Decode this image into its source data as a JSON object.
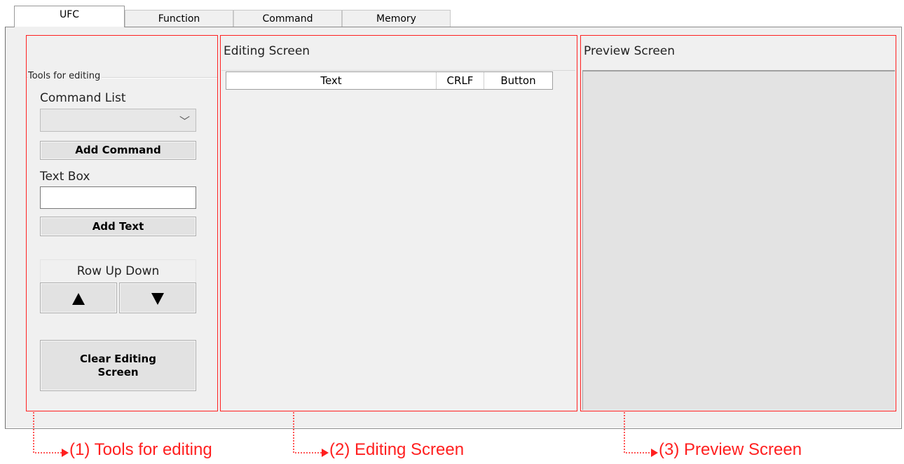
{
  "tabs": [
    {
      "label": "UFC",
      "active": true
    },
    {
      "label": "Function",
      "active": false
    },
    {
      "label": "Command",
      "active": false
    },
    {
      "label": "Memory",
      "active": false
    }
  ],
  "tools": {
    "group_label": "Tools for editing",
    "command_list_label": "Command List",
    "command_list_value": "",
    "add_command_label": "Add Command",
    "text_box_label": "Text Box",
    "text_box_value": "",
    "add_text_label": "Add Text",
    "row_up_down_label": "Row Up Down",
    "up_symbol": "▲",
    "down_symbol": "▼",
    "clear_line1": "Clear Editing",
    "clear_line2": "Screen"
  },
  "editing": {
    "title": "Editing Screen",
    "columns": [
      "Text",
      "CRLF",
      "Button"
    ]
  },
  "preview": {
    "title": "Preview Screen"
  },
  "callouts": [
    "(1) Tools for editing",
    "(2) Editing Screen",
    "(3) Preview Screen"
  ],
  "colors": {
    "highlight": "#ff1f1f",
    "window_bg": "#f0f0f0",
    "preview_bg": "#e3e3e3"
  }
}
